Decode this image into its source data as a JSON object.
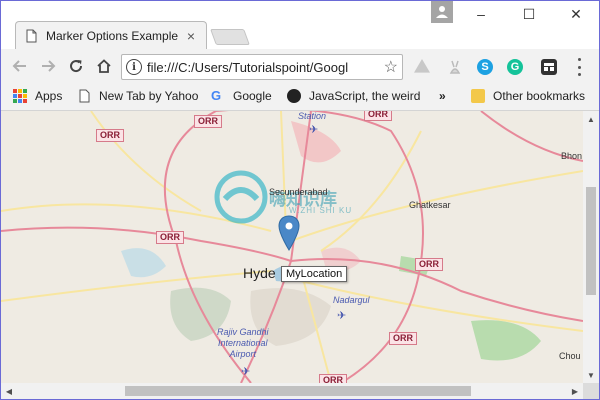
{
  "tab": {
    "title": "Marker Options Example",
    "close": "×"
  },
  "window_controls": {
    "minimize": "–",
    "maximize": "☐",
    "close": "✕"
  },
  "toolbar": {
    "url": "file:///C:/Users/Tutorialspoint/Googl",
    "star": "☆"
  },
  "bookmarks": {
    "apps": "Apps",
    "items": [
      "New Tab by Yahoo",
      "Google",
      "JavaScript, the weird"
    ],
    "overflow": "»",
    "other": "Other bookmarks"
  },
  "map": {
    "places": {
      "station": "Station",
      "secunderabad": "Secunderabad",
      "ghatkesar": "Ghatkesar",
      "bhon": "Bhon",
      "hyderabad": "Hyde",
      "nadargul": "Nadargul",
      "airport": "Rajiv Gandhi\nInternational\nAirport",
      "chou": "Chou"
    },
    "shields": [
      "ORR",
      "ORR",
      "ORR",
      "ORR",
      "ORR",
      "ORR",
      "ORR"
    ],
    "marker_tooltip": "MyLocation",
    "watermark": "嗨知识库",
    "watermark_sub": "W.ZHI SHI KU"
  },
  "icons": [
    "page-icon",
    "back-arrow-icon",
    "forward-arrow-icon",
    "reload-icon",
    "home-icon",
    "info-icon",
    "star-icon",
    "apps-icon",
    "google-icon",
    "folder-icon",
    "map-pin-icon",
    "airport-icon"
  ],
  "colors": {
    "accent": "#4a88c7",
    "map_bg": "#efebe3",
    "highway": "#e7899a"
  }
}
